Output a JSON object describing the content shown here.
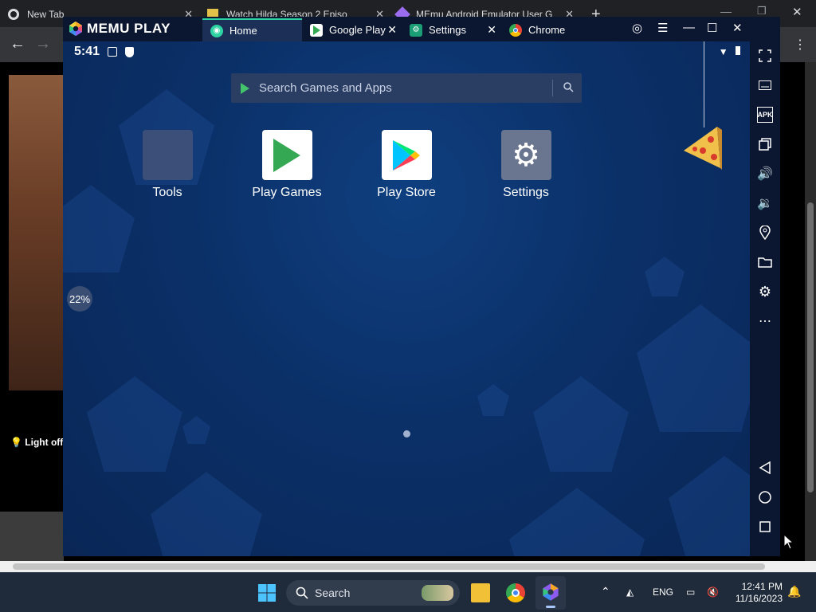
{
  "chrome": {
    "tabs": [
      {
        "label": "New Tab"
      },
      {
        "label": "Watch Hilda Season 2 Episo"
      },
      {
        "label": "MEmu Android Emulator User G"
      }
    ],
    "new_tab": "+",
    "page": {
      "light_off": "Light off"
    }
  },
  "memu": {
    "logo": "MEMU PLAY",
    "tabs": [
      {
        "label": "Home"
      },
      {
        "label": "Google Play"
      },
      {
        "label": "Settings"
      },
      {
        "label": "Chrome"
      }
    ],
    "android": {
      "time": "5:41",
      "search_placeholder": "Search Games and Apps",
      "apps": [
        {
          "label": "Tools",
          "icon": "tools-folder-icon"
        },
        {
          "label": "Play Games",
          "icon": "play-games-icon"
        },
        {
          "label": "Play Store",
          "icon": "play-store-icon"
        },
        {
          "label": "Settings",
          "icon": "settings-gear-icon"
        }
      ],
      "progress_pct": 22,
      "progress_label": "22%",
      "page_dots": 1
    },
    "sidebar": [
      "fullscreen-icon",
      "keyboard-icon",
      "apk-icon",
      "multi-instance-icon",
      "volume-up-icon",
      "volume-down-icon",
      "location-icon",
      "folder-icon",
      "settings-icon",
      "more-icon",
      "back-icon",
      "home-icon",
      "recents-icon"
    ]
  },
  "taskbar": {
    "search_label": "Search",
    "lang": "ENG",
    "time": "12:41 PM",
    "date": "11/16/2023"
  },
  "colors": {
    "memu_frame": "#0b1630",
    "android_bg": "#0b3068",
    "tab_accent": "#2ed3a3"
  }
}
